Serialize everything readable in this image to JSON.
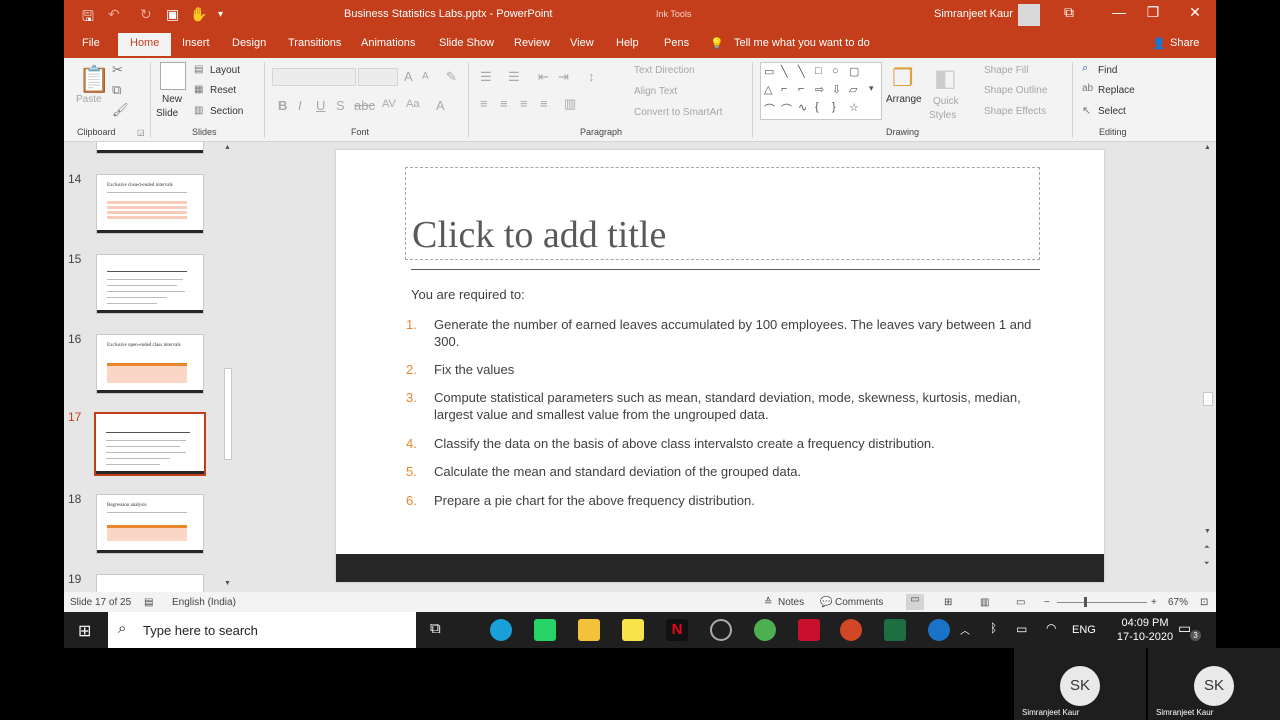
{
  "titlebar": {
    "document_title": "Business Statistics Labs.pptx  -  PowerPoint",
    "ink_tools": "Ink Tools",
    "user_name": "Simranjeet Kaur",
    "minimize": "—",
    "restore": "❐",
    "close": "✕",
    "ribbon_display": "⧉"
  },
  "tabs": [
    "File",
    "Home",
    "Insert",
    "Design",
    "Transitions",
    "Animations",
    "Slide Show",
    "Review",
    "View",
    "Help",
    "Pens"
  ],
  "tell_me": "Tell me what you want to do",
  "share": "Share",
  "ribbon": {
    "clipboard": {
      "label": "Clipboard",
      "paste": "Paste"
    },
    "slides": {
      "label": "Slides",
      "new_slide": "New",
      "new_slide2": "Slide",
      "layout": "Layout",
      "reset": "Reset",
      "section": "Section"
    },
    "font": {
      "label": "Font"
    },
    "paragraph": {
      "label": "Paragraph",
      "text_direction": "Text Direction",
      "align_text": "Align Text",
      "convert": "Convert to SmartArt"
    },
    "drawing": {
      "label": "Drawing",
      "arrange": "Arrange",
      "quick_styles": "Quick",
      "quick_styles2": "Styles",
      "shape_fill": "Shape Fill",
      "shape_outline": "Shape Outline",
      "shape_effects": "Shape Effects"
    },
    "editing": {
      "label": "Editing",
      "find": "Find",
      "replace": "Replace",
      "select": "Select"
    }
  },
  "thumbnails": [
    {
      "num": "14",
      "title": "Exclusive closed-ended intervals"
    },
    {
      "num": "15",
      "title": ""
    },
    {
      "num": "16",
      "title": "Exclusive open-ended class intervals"
    },
    {
      "num": "17",
      "title": ""
    },
    {
      "num": "18",
      "title": "Regression analysis"
    },
    {
      "num": "19",
      "title": ""
    }
  ],
  "slide": {
    "title_placeholder": "Click to add title",
    "intro": "You are required to:",
    "items": [
      {
        "n": "1.",
        "text": "Generate the number of earned leaves accumulated by 100 employees. The leaves vary between 1 and 300."
      },
      {
        "n": "2.",
        "text": "Fix the values"
      },
      {
        "n": "3.",
        "text": "Compute statistical parameters such as mean, standard deviation, mode, skewness, kurtosis, median, largest value and smallest value from the ungrouped data."
      },
      {
        "n": "4.",
        "text": "Classify the data on the basis of above class intervalsto create a frequency distribution."
      },
      {
        "n": "5.",
        "text": "Calculate the mean and standard deviation of the grouped data."
      },
      {
        "n": "6.",
        "text": "Prepare a pie chart for the above frequency distribution."
      }
    ]
  },
  "status": {
    "slide_count": "Slide 17 of 25",
    "language": "English (India)",
    "notes": "Notes",
    "comments": "Comments",
    "zoom": "67%",
    "zoom_minus": "−",
    "zoom_plus": "+"
  },
  "taskbar": {
    "search_placeholder": "Type here to search",
    "time": "04:09 PM",
    "date": "17-10-2020",
    "lang": "ENG",
    "notif_count": "3"
  },
  "participants": [
    {
      "initials": "SK",
      "name": "Simranjeet Kaur"
    },
    {
      "initials": "SK",
      "name": "Simranjeet Kaur"
    }
  ],
  "colors": {
    "accent": "#c43e1c",
    "bullet": "#e8862b",
    "footer": "#262626"
  }
}
